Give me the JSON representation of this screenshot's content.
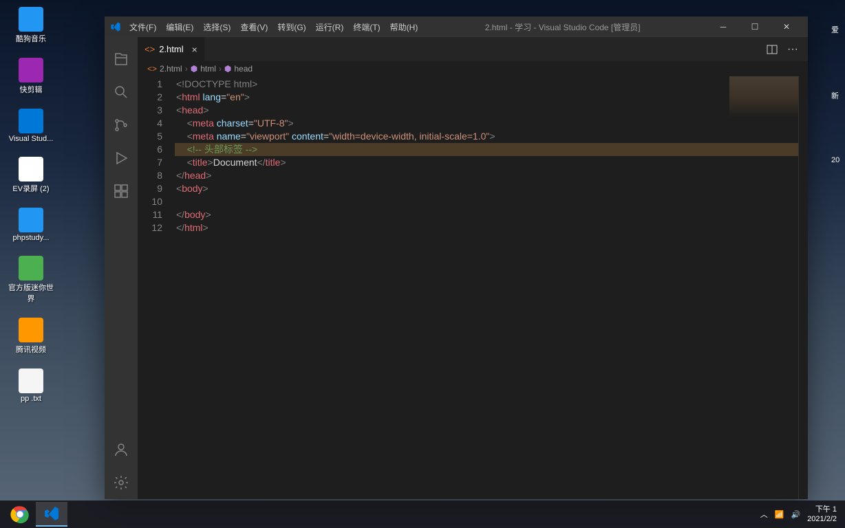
{
  "desktop": {
    "icons": [
      {
        "label": "酷狗音乐",
        "color": "#2196f3"
      },
      {
        "label": "快剪辑",
        "color": "#9c27b0"
      },
      {
        "label": "Visual Stud...",
        "color": "#0078d7"
      },
      {
        "label": "EV录屏 (2)",
        "color": "#ffffff"
      },
      {
        "label": "phpstudy...",
        "color": "#2196f3"
      },
      {
        "label": "官方版迷你世界",
        "color": "#4caf50"
      },
      {
        "label": "腾讯视频",
        "color": "#ff9800"
      },
      {
        "label": "pp .txt",
        "color": "#f5f5f5"
      }
    ],
    "right_partial": [
      "爱",
      "新",
      "20"
    ]
  },
  "vscode": {
    "window_title": "2.html - 学习 - Visual Studio Code [管理员]",
    "menu": [
      "文件(F)",
      "编辑(E)",
      "选择(S)",
      "查看(V)",
      "转到(G)",
      "运行(R)",
      "终端(T)",
      "帮助(H)"
    ],
    "tab": {
      "name": "2.html"
    },
    "breadcrumb": [
      "2.html",
      "html",
      "head"
    ],
    "code": {
      "lines": [
        {
          "n": 1,
          "tokens": [
            [
              "bracket",
              "<!"
            ],
            [
              "doctype",
              "DOCTYPE html"
            ],
            [
              "bracket",
              ">"
            ]
          ]
        },
        {
          "n": 2,
          "tokens": [
            [
              "bracket",
              "<"
            ],
            [
              "tag",
              "html"
            ],
            [
              "text",
              " "
            ],
            [
              "attr",
              "lang"
            ],
            [
              "text",
              "="
            ],
            [
              "string",
              "\"en\""
            ],
            [
              "bracket",
              ">"
            ]
          ]
        },
        {
          "n": 3,
          "tokens": [
            [
              "bracket",
              "<"
            ],
            [
              "tag",
              "head"
            ],
            [
              "bracket",
              ">"
            ]
          ]
        },
        {
          "n": 4,
          "indent": 4,
          "tokens": [
            [
              "bracket",
              "<"
            ],
            [
              "tag",
              "meta"
            ],
            [
              "text",
              " "
            ],
            [
              "attr",
              "charset"
            ],
            [
              "text",
              "="
            ],
            [
              "string",
              "\"UTF-8\""
            ],
            [
              "bracket",
              ">"
            ]
          ]
        },
        {
          "n": 5,
          "indent": 4,
          "tokens": [
            [
              "bracket",
              "<"
            ],
            [
              "tag",
              "meta"
            ],
            [
              "text",
              " "
            ],
            [
              "attr",
              "name"
            ],
            [
              "text",
              "="
            ],
            [
              "string",
              "\"viewport\""
            ],
            [
              "text",
              " "
            ],
            [
              "attr",
              "content"
            ],
            [
              "text",
              "="
            ],
            [
              "string",
              "\"width=device-width, initial-scale=1.0\""
            ],
            [
              "bracket",
              ">"
            ]
          ]
        },
        {
          "n": 6,
          "indent": 4,
          "highlight": true,
          "tokens": [
            [
              "comment",
              "<!-- 头部标签 -->"
            ]
          ]
        },
        {
          "n": 7,
          "indent": 4,
          "tokens": [
            [
              "bracket",
              "<"
            ],
            [
              "tag",
              "title"
            ],
            [
              "bracket",
              ">"
            ],
            [
              "text",
              "Document"
            ],
            [
              "bracket",
              "</"
            ],
            [
              "tag",
              "title"
            ],
            [
              "bracket",
              ">"
            ]
          ]
        },
        {
          "n": 8,
          "tokens": [
            [
              "bracket",
              "</"
            ],
            [
              "tag",
              "head"
            ],
            [
              "bracket",
              ">"
            ]
          ]
        },
        {
          "n": 9,
          "tokens": [
            [
              "bracket",
              "<"
            ],
            [
              "tag",
              "body"
            ],
            [
              "bracket",
              ">"
            ]
          ]
        },
        {
          "n": 10,
          "tokens": []
        },
        {
          "n": 11,
          "tokens": [
            [
              "bracket",
              "</"
            ],
            [
              "tag",
              "body"
            ],
            [
              "bracket",
              ">"
            ]
          ]
        },
        {
          "n": 12,
          "tokens": [
            [
              "bracket",
              "</"
            ],
            [
              "tag",
              "html"
            ],
            [
              "bracket",
              ">"
            ]
          ]
        }
      ]
    }
  },
  "taskbar": {
    "time": "下午 1",
    "date": "2021/2/2"
  }
}
